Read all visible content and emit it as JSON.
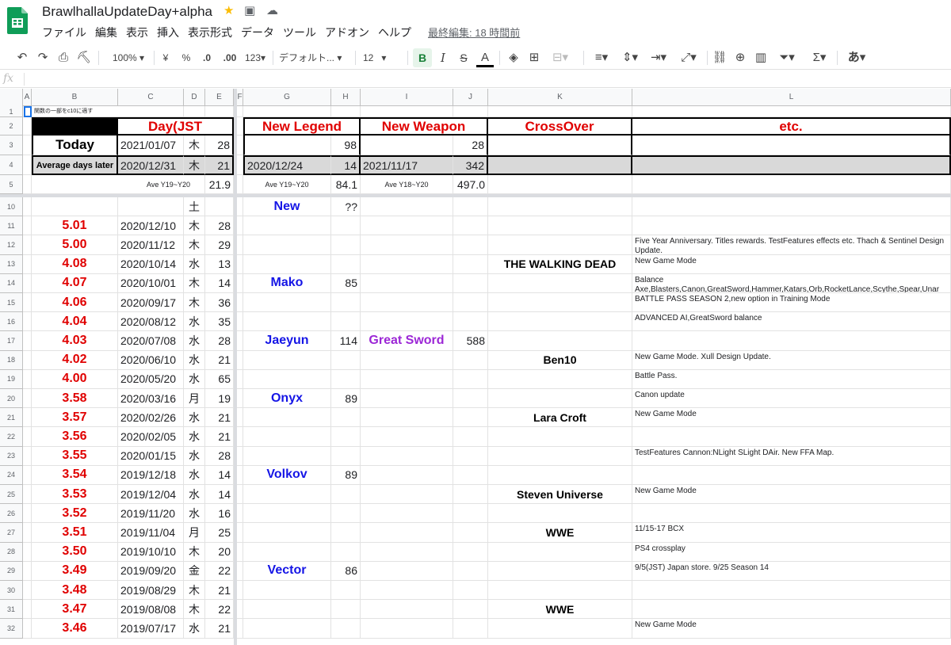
{
  "app": {
    "title": "BrawlhallaUpdateDay+alpha",
    "icons": {
      "star": "star-icon",
      "move": "move-to-folder-icon",
      "cloud": "cloud-saved-icon"
    },
    "menu": [
      "ファイル",
      "編集",
      "表示",
      "挿入",
      "表示形式",
      "データ",
      "ツール",
      "アドオン",
      "ヘルプ"
    ],
    "last_edit": "最終編集: 18 時間前"
  },
  "toolbar": {
    "zoom": "100%",
    "currency": "¥",
    "percent": "%",
    "dec_decrease": ".0",
    "dec_increase": ".00",
    "format_more": "123",
    "font": "デフォルト...",
    "font_size": "12",
    "bold": "B",
    "italic": "I",
    "strike": "S",
    "text_color": "A",
    "functions": "Σ",
    "input_mode": "あ"
  },
  "formula_bar": {
    "fx": "fx",
    "value": ""
  },
  "columns": [
    "A",
    "B",
    "C",
    "D",
    "E",
    "F",
    "G",
    "H",
    "I",
    "J",
    "K",
    "L"
  ],
  "header_rows": {
    "r1": {
      "num": "1",
      "note": "関数の一部をc10に適す"
    },
    "r2": {
      "num": "2",
      "day": "Day(JST",
      "legend": "New Legend",
      "weapon": "New Weapon",
      "crossover": "CrossOver",
      "etc": "etc."
    },
    "r3": {
      "num": "3",
      "label": "Today",
      "date": "2021/01/07",
      "dow": "木",
      "days": "28",
      "legend_days": "98",
      "weapon_days": "28"
    },
    "r4": {
      "num": "4",
      "label": "Average days later",
      "date": "2020/12/31",
      "dow": "木",
      "days": "21",
      "legend_date": "2020/12/24",
      "legend_days": "14",
      "weapon_date": "2021/11/17",
      "weapon_days": "342"
    },
    "r5": {
      "num": "5",
      "ave_label_day": "Ave Y19~Y20",
      "ave_day": "21.9",
      "ave_label_legend": "Ave Y19~Y20",
      "ave_legend": "84.1",
      "ave_label_weapon": "Ave Y18~Y20",
      "ave_weapon": "497.0"
    }
  },
  "rows": [
    {
      "num": "10",
      "ver": "",
      "date": "",
      "dow": "土",
      "days": "",
      "legend": "New",
      "ldays": "??",
      "weapon": "",
      "wdays": "",
      "cross": "",
      "etc": ""
    },
    {
      "num": "11",
      "ver": "5.01",
      "date": "2020/12/10",
      "dow": "木",
      "days": "28",
      "legend": "",
      "ldays": "",
      "weapon": "",
      "wdays": "",
      "cross": "",
      "etc": ""
    },
    {
      "num": "12",
      "ver": "5.00",
      "date": "2020/11/12",
      "dow": "木",
      "days": "29",
      "legend": "",
      "ldays": "",
      "weapon": "",
      "wdays": "",
      "cross": "",
      "etc": "Five Year Anniversary. Titles rewards. TestFeatures effects etc. Thach & Sentinel Design Update."
    },
    {
      "num": "13",
      "ver": "4.08",
      "date": "2020/10/14",
      "dow": "水",
      "days": "13",
      "legend": "",
      "ldays": "",
      "weapon": "",
      "wdays": "",
      "cross": "THE WALKING DEAD",
      "etc": "New Game Mode"
    },
    {
      "num": "14",
      "ver": "4.07",
      "date": "2020/10/01",
      "dow": "木",
      "days": "14",
      "legend": "Mako",
      "ldays": "85",
      "weapon": "",
      "wdays": "",
      "cross": "",
      "etc": "Balance Axe,Blasters,Canon,GreatSword,Hammer,Katars,Orb,RocketLance,Scythe,Spear,Unar"
    },
    {
      "num": "15",
      "ver": "4.06",
      "date": "2020/09/17",
      "dow": "木",
      "days": "36",
      "legend": "",
      "ldays": "",
      "weapon": "",
      "wdays": "",
      "cross": "",
      "etc": "BATTLE PASS SEASON 2,new option in Training Mode"
    },
    {
      "num": "16",
      "ver": "4.04",
      "date": "2020/08/12",
      "dow": "水",
      "days": "35",
      "legend": "",
      "ldays": "",
      "weapon": "",
      "wdays": "",
      "cross": "",
      "etc": "ADVANCED AI,GreatSword balance"
    },
    {
      "num": "17",
      "ver": "4.03",
      "date": "2020/07/08",
      "dow": "水",
      "days": "28",
      "legend": "Jaeyun",
      "ldays": "114",
      "weapon": "Great Sword",
      "wdays": "588",
      "cross": "",
      "etc": ""
    },
    {
      "num": "18",
      "ver": "4.02",
      "date": "2020/06/10",
      "dow": "水",
      "days": "21",
      "legend": "",
      "ldays": "",
      "weapon": "",
      "wdays": "",
      "cross": "Ben10",
      "etc": "New Game Mode. Xull Design Update."
    },
    {
      "num": "19",
      "ver": "4.00",
      "date": "2020/05/20",
      "dow": "水",
      "days": "65",
      "legend": "",
      "ldays": "",
      "weapon": "",
      "wdays": "",
      "cross": "",
      "etc": "Battle Pass."
    },
    {
      "num": "20",
      "ver": "3.58",
      "date": "2020/03/16",
      "dow": "月",
      "days": "19",
      "legend": "Onyx",
      "ldays": "89",
      "weapon": "",
      "wdays": "",
      "cross": "",
      "etc": "Canon update"
    },
    {
      "num": "21",
      "ver": "3.57",
      "date": "2020/02/26",
      "dow": "水",
      "days": "21",
      "legend": "",
      "ldays": "",
      "weapon": "",
      "wdays": "",
      "cross": "Lara Croft",
      "etc": "New Game Mode"
    },
    {
      "num": "22",
      "ver": "3.56",
      "date": "2020/02/05",
      "dow": "水",
      "days": "21",
      "legend": "",
      "ldays": "",
      "weapon": "",
      "wdays": "",
      "cross": "",
      "etc": ""
    },
    {
      "num": "23",
      "ver": "3.55",
      "date": "2020/01/15",
      "dow": "水",
      "days": "28",
      "legend": "",
      "ldays": "",
      "weapon": "",
      "wdays": "",
      "cross": "",
      "etc": "TestFeatures Cannon:NLight SLight DAir. New FFA Map."
    },
    {
      "num": "24",
      "ver": "3.54",
      "date": "2019/12/18",
      "dow": "水",
      "days": "14",
      "legend": "Volkov",
      "ldays": "89",
      "weapon": "",
      "wdays": "",
      "cross": "",
      "etc": ""
    },
    {
      "num": "25",
      "ver": "3.53",
      "date": "2019/12/04",
      "dow": "水",
      "days": "14",
      "legend": "",
      "ldays": "",
      "weapon": "",
      "wdays": "",
      "cross": "Steven Universe",
      "etc": "New Game Mode"
    },
    {
      "num": "26",
      "ver": "3.52",
      "date": "2019/11/20",
      "dow": "水",
      "days": "16",
      "legend": "",
      "ldays": "",
      "weapon": "",
      "wdays": "",
      "cross": "",
      "etc": ""
    },
    {
      "num": "27",
      "ver": "3.51",
      "date": "2019/11/04",
      "dow": "月",
      "days": "25",
      "legend": "",
      "ldays": "",
      "weapon": "",
      "wdays": "",
      "cross": "WWE",
      "etc": "11/15-17 BCX"
    },
    {
      "num": "28",
      "ver": "3.50",
      "date": "2019/10/10",
      "dow": "木",
      "days": "20",
      "legend": "",
      "ldays": "",
      "weapon": "",
      "wdays": "",
      "cross": "",
      "etc": "PS4 crossplay"
    },
    {
      "num": "29",
      "ver": "3.49",
      "date": "2019/09/20",
      "dow": "金",
      "days": "22",
      "legend": "Vector",
      "ldays": "86",
      "weapon": "",
      "wdays": "",
      "cross": "",
      "etc": "9/5(JST) Japan store. 9/25 Season 14"
    },
    {
      "num": "30",
      "ver": "3.48",
      "date": "2019/08/29",
      "dow": "木",
      "days": "21",
      "legend": "",
      "ldays": "",
      "weapon": "",
      "wdays": "",
      "cross": "",
      "etc": ""
    },
    {
      "num": "31",
      "ver": "3.47",
      "date": "2019/08/08",
      "dow": "木",
      "days": "22",
      "legend": "",
      "ldays": "",
      "weapon": "",
      "wdays": "",
      "cross": "WWE",
      "etc": ""
    },
    {
      "num": "32",
      "ver": "3.46",
      "date": "2019/07/17",
      "dow": "水",
      "days": "21",
      "legend": "",
      "ldays": "",
      "weapon": "",
      "wdays": "",
      "cross": "",
      "etc": "New Game Mode"
    }
  ]
}
